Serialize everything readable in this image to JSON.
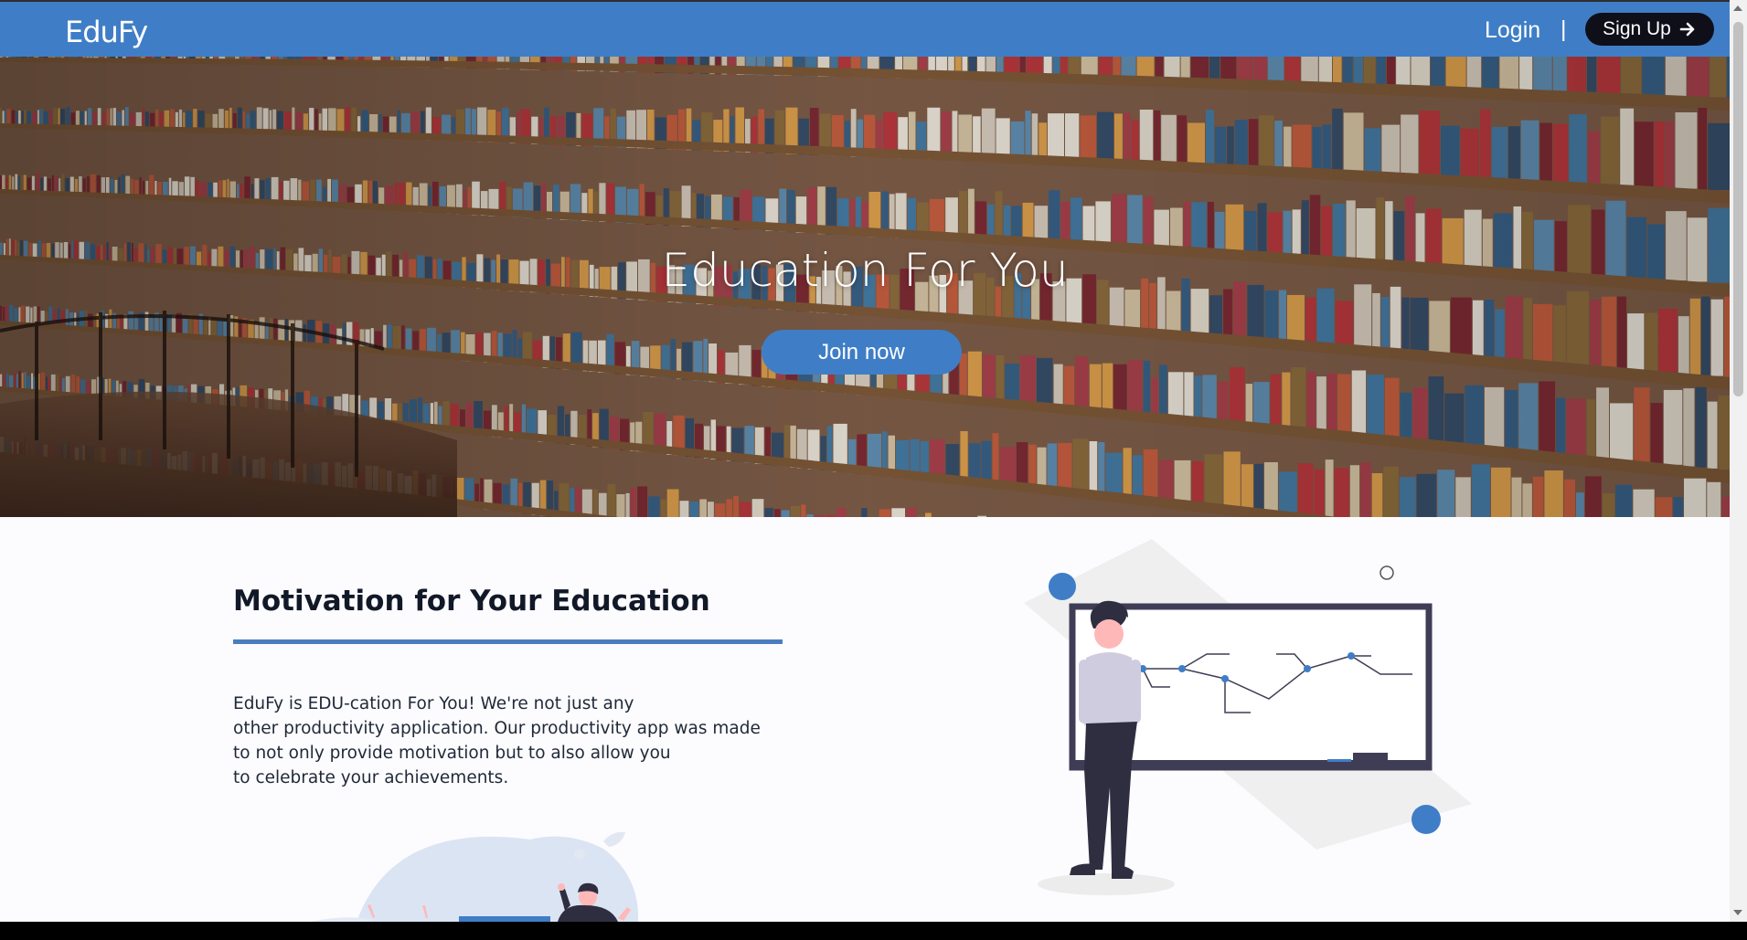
{
  "nav": {
    "brand": "EduFy",
    "login": "Login",
    "divider": "|",
    "signup": "Sign Up"
  },
  "hero": {
    "title": "Education For You",
    "cta": "Join now"
  },
  "motivation": {
    "title": "Motivation for Your Education",
    "body_lines": [
      "EduFy is EDU-cation For You! We're not just any",
      "other productivity application. Our productivity app was made",
      "to not only provide motivation but to also allow you",
      "to celebrate your achievements."
    ]
  },
  "colors": {
    "primary": "#3f7ec6",
    "dark": "#0f0f19"
  }
}
